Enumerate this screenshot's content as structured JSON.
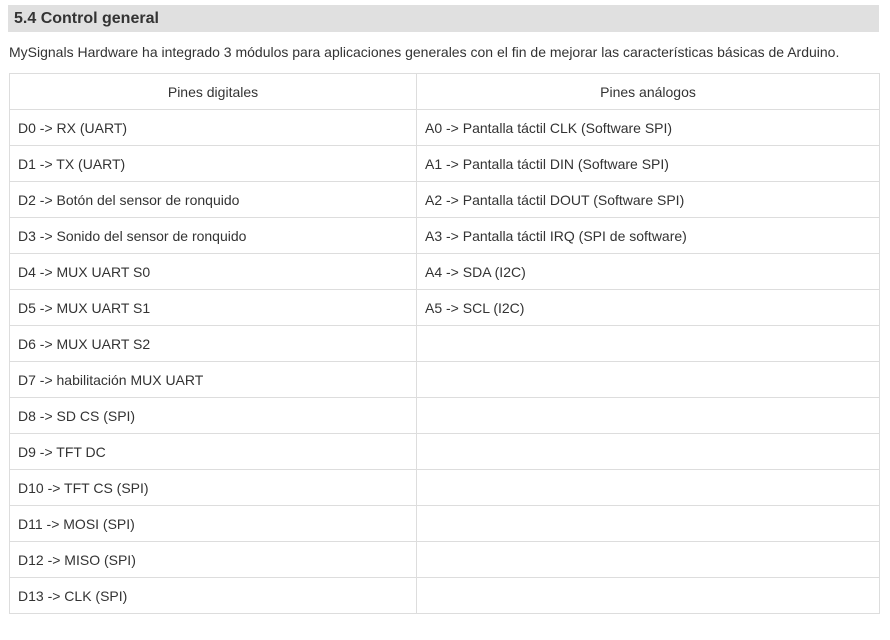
{
  "section": {
    "title": "5.4 Control general"
  },
  "intro": "MySignals Hardware ha integrado 3 módulos para aplicaciones generales con el fin de mejorar las características básicas de Arduino.",
  "table": {
    "headers": [
      "Pines digitales",
      "Pines análogos"
    ],
    "rows": [
      [
        "D0 -> RX (UART)",
        "A0 -> Pantalla táctil CLK (Software SPI)"
      ],
      [
        "D1 -> TX (UART)",
        "A1 -> Pantalla táctil DIN (Software SPI)"
      ],
      [
        "D2 -> Botón del sensor de ronquido",
        "A2 -> Pantalla táctil DOUT (Software SPI)"
      ],
      [
        "D3 -> Sonido del sensor de ronquido",
        "A3 -> Pantalla táctil IRQ (SPI de software)"
      ],
      [
        "D4 -> MUX UART S0",
        "A4 -> SDA (I2C)"
      ],
      [
        "D5 -> MUX UART S1",
        "A5 -> SCL (I2C)"
      ],
      [
        "D6 -> MUX UART S2",
        ""
      ],
      [
        "D7 -> habilitación MUX UART",
        ""
      ],
      [
        "D8 -> SD CS (SPI)",
        ""
      ],
      [
        "D9 -> TFT DC",
        ""
      ],
      [
        "D10 -> TFT CS (SPI)",
        ""
      ],
      [
        "D11 -> MOSI (SPI)",
        ""
      ],
      [
        "D12 -> MISO (SPI)",
        ""
      ],
      [
        "D13 -> CLK (SPI)",
        ""
      ]
    ]
  }
}
